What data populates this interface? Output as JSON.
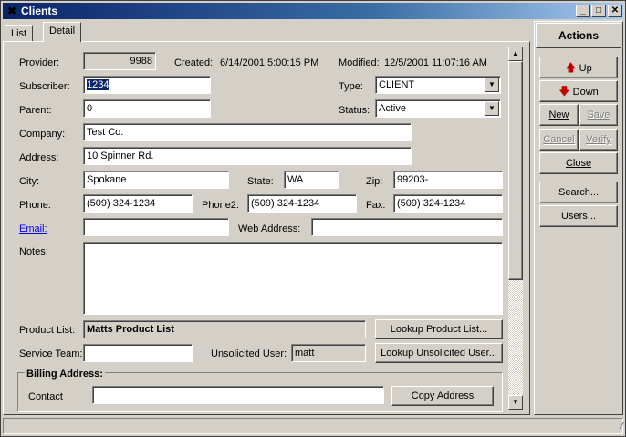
{
  "window": {
    "title": "Clients"
  },
  "tabs": [
    {
      "label": "List"
    },
    {
      "label": "Detail"
    }
  ],
  "form": {
    "provider_label": "Provider:",
    "provider_value": "9988",
    "created_label": "Created:",
    "created_value": "6/14/2001 5:00:15 PM",
    "modified_label": "Modified:",
    "modified_value": "12/5/2001 11:07:16 AM",
    "subscriber_label": "Subscriber:",
    "subscriber_value": "1234",
    "type_label": "Type:",
    "type_value": "CLIENT",
    "parent_label": "Parent:",
    "parent_value": "0",
    "status_label": "Status:",
    "status_value": "Active",
    "company_label": "Company:",
    "company_value": "Test Co.",
    "address_label": "Address:",
    "address_value": "10 Spinner Rd.",
    "city_label": "City:",
    "city_value": "Spokane",
    "state_label": "State:",
    "state_value": "WA",
    "zip_label": "Zip:",
    "zip_value": "99203-",
    "phone_label": "Phone:",
    "phone_value": "(509) 324-1234",
    "phone2_label": "Phone2:",
    "phone2_value": "(509) 324-1234",
    "fax_label": "Fax:",
    "fax_value": "(509) 324-1234",
    "email_label": "Email:",
    "email_value": "",
    "web_label": "Web Address:",
    "web_value": "",
    "notes_label": "Notes:",
    "notes_value": "",
    "product_list_label": "Product List:",
    "product_list_value": "Matts Product List",
    "lookup_product_label": "Lookup Product List...",
    "service_team_label": "Service Team:",
    "service_team_value": "",
    "unsolicited_label": "Unsolicited User:",
    "unsolicited_value": "matt",
    "lookup_unsolicited_label": "Lookup Unsolicited User...",
    "billing_title": "Billing Address:",
    "contact_label": "Contact",
    "contact_value": "",
    "copy_address_label": "Copy Address"
  },
  "actions": {
    "title": "Actions",
    "up_label": "Up",
    "down_label": "Down",
    "new_label": "New",
    "save_label": "Save",
    "cancel_label": "Cancel",
    "verify_label": "Verify",
    "close_label": "Close",
    "search_label": "Search...",
    "users_label": "Users..."
  }
}
